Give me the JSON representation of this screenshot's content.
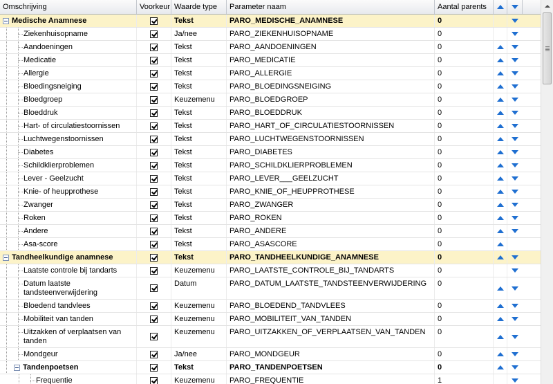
{
  "columns": {
    "name": "Omschrijving",
    "preferred": "Voorkeur",
    "value_type": "Waarde type",
    "param": "Parameter naam",
    "parents": "Aantal parents"
  },
  "icons": {
    "up": "arrow-up-icon",
    "down": "arrow-down-icon",
    "checkbox": "checkbox-checked-icon",
    "expander": "collapse-minus-icon"
  },
  "colors": {
    "group_bg": "#fcf3c8",
    "arrow": "#1f6fd1"
  },
  "rows": [
    {
      "name": "Medische Anamnese",
      "group": true,
      "level": 0,
      "checked": true,
      "type": "Tekst",
      "param": "PARO_MEDISCHE_ANAMNESE",
      "count": "0",
      "up": false,
      "down": true,
      "h": 19
    },
    {
      "name": "Ziekenhuisopname",
      "group": false,
      "level": 1,
      "checked": true,
      "type": "Ja/nee",
      "param": "PARO_ZIEKENHUISOPNAME",
      "count": "0",
      "up": false,
      "down": true,
      "h": 19
    },
    {
      "name": "Aandoeningen",
      "group": false,
      "level": 1,
      "checked": true,
      "type": "Tekst",
      "param": "PARO_AANDOENINGEN",
      "count": "0",
      "up": true,
      "down": true,
      "h": 19
    },
    {
      "name": "Medicatie",
      "group": false,
      "level": 1,
      "checked": true,
      "type": "Tekst",
      "param": "PARO_MEDICATIE",
      "count": "0",
      "up": true,
      "down": true,
      "h": 19
    },
    {
      "name": "Allergie",
      "group": false,
      "level": 1,
      "checked": true,
      "type": "Tekst",
      "param": "PARO_ALLERGIE",
      "count": "0",
      "up": true,
      "down": true,
      "h": 19
    },
    {
      "name": "Bloedingsneiging",
      "group": false,
      "level": 1,
      "checked": true,
      "type": "Tekst",
      "param": "PARO_BLOEDINGSNEIGING",
      "count": "0",
      "up": true,
      "down": true,
      "h": 19
    },
    {
      "name": "Bloedgroep",
      "group": false,
      "level": 1,
      "checked": true,
      "type": "Keuzemenu",
      "param": "PARO_BLOEDGROEP",
      "count": "0",
      "up": true,
      "down": true,
      "h": 19
    },
    {
      "name": "Bloeddruk",
      "group": false,
      "level": 1,
      "checked": true,
      "type": "Tekst",
      "param": "PARO_BLOEDDRUK",
      "count": "0",
      "up": true,
      "down": true,
      "h": 19
    },
    {
      "name": "Hart- of circulatiestoornissen",
      "group": false,
      "level": 1,
      "checked": true,
      "type": "Tekst",
      "param": "PARO_HART_OF_CIRCULATIESTOORNISSEN",
      "count": "0",
      "up": true,
      "down": true,
      "h": 19
    },
    {
      "name": "Luchtwegenstoornissen",
      "group": false,
      "level": 1,
      "checked": true,
      "type": "Tekst",
      "param": "PARO_LUCHTWEGENSTOORNISSEN",
      "count": "0",
      "up": true,
      "down": true,
      "h": 19
    },
    {
      "name": "Diabetes",
      "group": false,
      "level": 1,
      "checked": true,
      "type": "Tekst",
      "param": "PARO_DIABETES",
      "count": "0",
      "up": true,
      "down": true,
      "h": 19
    },
    {
      "name": "Schildklierproblemen",
      "group": false,
      "level": 1,
      "checked": true,
      "type": "Tekst",
      "param": "PARO_SCHILDKLIERPROBLEMEN",
      "count": "0",
      "up": true,
      "down": true,
      "h": 19
    },
    {
      "name": "Lever - Geelzucht",
      "group": false,
      "level": 1,
      "checked": true,
      "type": "Tekst",
      "param": "PARO_LEVER___GEELZUCHT",
      "count": "0",
      "up": true,
      "down": true,
      "h": 19
    },
    {
      "name": "Knie- of heupprothese",
      "group": false,
      "level": 1,
      "checked": true,
      "type": "Tekst",
      "param": "PARO_KNIE_OF_HEUPPROTHESE",
      "count": "0",
      "up": true,
      "down": true,
      "h": 19
    },
    {
      "name": "Zwanger",
      "group": false,
      "level": 1,
      "checked": true,
      "type": "Tekst",
      "param": "PARO_ZWANGER",
      "count": "0",
      "up": true,
      "down": true,
      "h": 19
    },
    {
      "name": "Roken",
      "group": false,
      "level": 1,
      "checked": true,
      "type": "Tekst",
      "param": "PARO_ROKEN",
      "count": "0",
      "up": true,
      "down": true,
      "h": 19
    },
    {
      "name": "Andere",
      "group": false,
      "level": 1,
      "checked": true,
      "type": "Tekst",
      "param": "PARO_ANDERE",
      "count": "0",
      "up": true,
      "down": true,
      "h": 19
    },
    {
      "name": "Asa-score",
      "group": false,
      "level": 1,
      "checked": true,
      "type": "Tekst",
      "param": "PARO_ASASCORE",
      "count": "0",
      "up": true,
      "down": false,
      "h": 19
    },
    {
      "name": "Tandheelkundige anamnese",
      "group": true,
      "level": 0,
      "checked": true,
      "type": "Tekst",
      "param": "PARO_TANDHEELKUNDIGE_ANAMNESE",
      "count": "0",
      "up": true,
      "down": true,
      "h": 19
    },
    {
      "name": "Laatste controle bij tandarts",
      "group": false,
      "level": 1,
      "checked": true,
      "type": "Keuzemenu",
      "param": "PARO_LAATSTE_CONTROLE_BIJ_TANDARTS",
      "count": "0",
      "up": false,
      "down": true,
      "h": 19
    },
    {
      "name": "Datum laatste tandsteenverwijdering",
      "group": false,
      "level": 1,
      "checked": true,
      "type": "Datum",
      "param": "PARO_DATUM_LAATSTE_TANDSTEENVERWIJDERING",
      "count": "0",
      "up": true,
      "down": true,
      "h": 32,
      "tall": true
    },
    {
      "name": "Bloedend tandvlees",
      "group": false,
      "level": 1,
      "checked": true,
      "type": "Keuzemenu",
      "param": "PARO_BLOEDEND_TANDVLEES",
      "count": "0",
      "up": true,
      "down": true,
      "h": 19
    },
    {
      "name": "Mobiliteit van tanden",
      "group": false,
      "level": 1,
      "checked": true,
      "type": "Keuzemenu",
      "param": "PARO_MOBILITEIT_VAN_TANDEN",
      "count": "0",
      "up": true,
      "down": true,
      "h": 19
    },
    {
      "name": "Uitzakken of verplaatsen van tanden",
      "group": false,
      "level": 1,
      "checked": true,
      "type": "Keuzemenu",
      "param": "PARO_UITZAKKEN_OF_VERPLAATSEN_VAN_TANDEN",
      "count": "0",
      "up": true,
      "down": true,
      "h": 32,
      "tall": true
    },
    {
      "name": "Mondgeur",
      "group": false,
      "level": 1,
      "checked": true,
      "type": "Ja/nee",
      "param": "PARO_MONDGEUR",
      "count": "0",
      "up": true,
      "down": true,
      "h": 19
    },
    {
      "name": "Tandenpoetsen",
      "group": true,
      "level": 1,
      "checked": true,
      "type": "Tekst",
      "param": "PARO_TANDENPOETSEN",
      "count": "0",
      "up": true,
      "down": true,
      "h": 19,
      "nobg": true
    },
    {
      "name": "Frequentie",
      "group": false,
      "level": 2,
      "checked": true,
      "type": "Keuzemenu",
      "param": "PARO_FREQUENTIE",
      "count": "1",
      "up": false,
      "down": true,
      "h": 19
    }
  ]
}
